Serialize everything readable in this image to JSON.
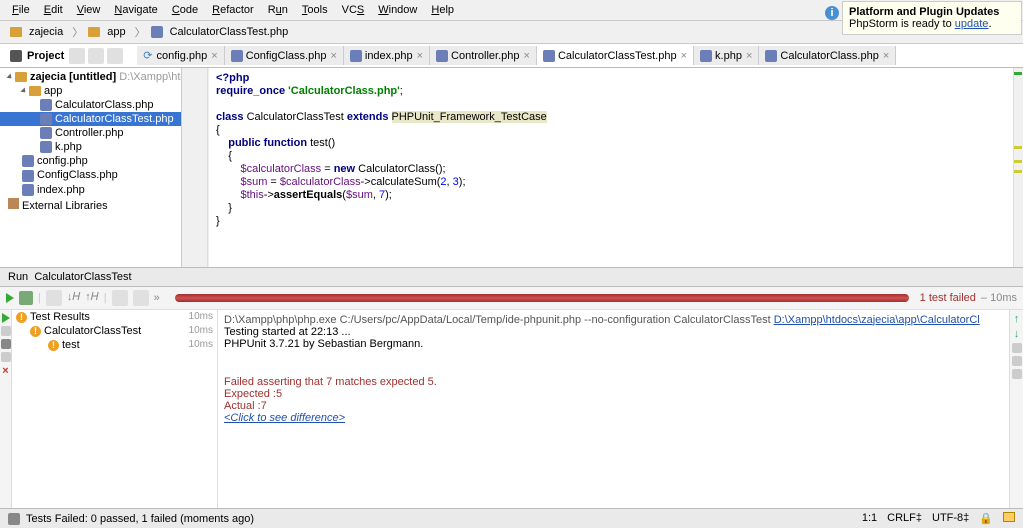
{
  "menu": [
    "File",
    "Edit",
    "View",
    "Navigate",
    "Code",
    "Refactor",
    "Run",
    "Tools",
    "VCS",
    "Window",
    "Help"
  ],
  "breadcrumb": [
    "zajecia",
    "app",
    "CalculatorClassTest.php"
  ],
  "project_label": "Project",
  "tabs": [
    {
      "label": "config.php",
      "active": false,
      "mod": true
    },
    {
      "label": "ConfigClass.php",
      "active": false
    },
    {
      "label": "index.php",
      "active": false
    },
    {
      "label": "Controller.php",
      "active": false
    },
    {
      "label": "CalculatorClassTest.php",
      "active": true
    },
    {
      "label": "k.php",
      "active": false
    },
    {
      "label": "CalculatorClass.php",
      "active": false
    }
  ],
  "tree": {
    "root": "zajecia [untitled]",
    "root_path": "D:\\Xampp\\htdocs\\z",
    "app": "app",
    "files_app": [
      "CalculatorClass.php",
      "CalculatorClassTest.php",
      "Controller.php",
      "k.php"
    ],
    "files_root": [
      "config.php",
      "ConfigClass.php",
      "index.php"
    ],
    "ext_lib": "External Libraries"
  },
  "code": {
    "l1a": "<?php",
    "l2a": "require_once",
    "l2b": "'CalculatorClass.php'",
    "l2c": ";",
    "l4a": "class ",
    "l4b": "CalculatorClassTest ",
    "l4c": "extends ",
    "l4d": "PHPUnit_Framework_TestCase",
    "l5": "{",
    "l6a": "public function ",
    "l6b": "test",
    "l6c": "()",
    "l7": "{",
    "l8a": "$calculatorClass",
    "l8b": " = ",
    "l8c": "new ",
    "l8d": "CalculatorClass();",
    "l9a": "$sum",
    "l9b": " = ",
    "l9c": "$calculatorClass",
    "l9d": "->calculateSum(",
    "l9e": "2",
    "l9f": ", ",
    "l9g": "3",
    "l9h": ");",
    "l10a": "$this",
    "l10b": "->",
    "l10c": "assertEquals",
    "l10d": "(",
    "l10e": "$sum",
    "l10f": ", ",
    "l10g": "7",
    "l10h": ");",
    "l11": "}",
    "l12": "}"
  },
  "run": {
    "title": "CalculatorClassTest",
    "tab": "Run",
    "fail": "1 test failed",
    "time": " – 10ms",
    "tree_root": "Test Results",
    "tree_root_ms": "10ms",
    "tree_l1": "CalculatorClassTest",
    "tree_l1_ms": "10ms",
    "tree_l2": "test",
    "tree_l2_ms": "10ms"
  },
  "console": {
    "l1a": "D:\\Xampp\\php\\php.exe C:/Users/pc/AppData/Local/Temp/ide-phpunit.php --no-configuration CalculatorClassTest ",
    "l1b": "D:\\Xampp\\htdocs\\zajecia\\app\\CalculatorCl",
    "l2": "Testing started at 22:13 ...",
    "l3": "PHPUnit 3.7.21 by Sebastian Bergmann.",
    "l5": "Failed asserting that 7 matches expected 5.",
    "l6": "Expected :5",
    "l7": "Actual   :7",
    "l8": "<Click to see difference>"
  },
  "status": {
    "left": "Tests Failed: 0 passed, 1 failed (moments ago)",
    "pos": "1:1",
    "crlf": "CRLF‡",
    "enc": "UTF-8‡"
  },
  "notif": {
    "title": "Platform and Plugin Updates",
    "body_a": "PhpStorm is ready to ",
    "body_b": "update",
    "body_c": "."
  }
}
